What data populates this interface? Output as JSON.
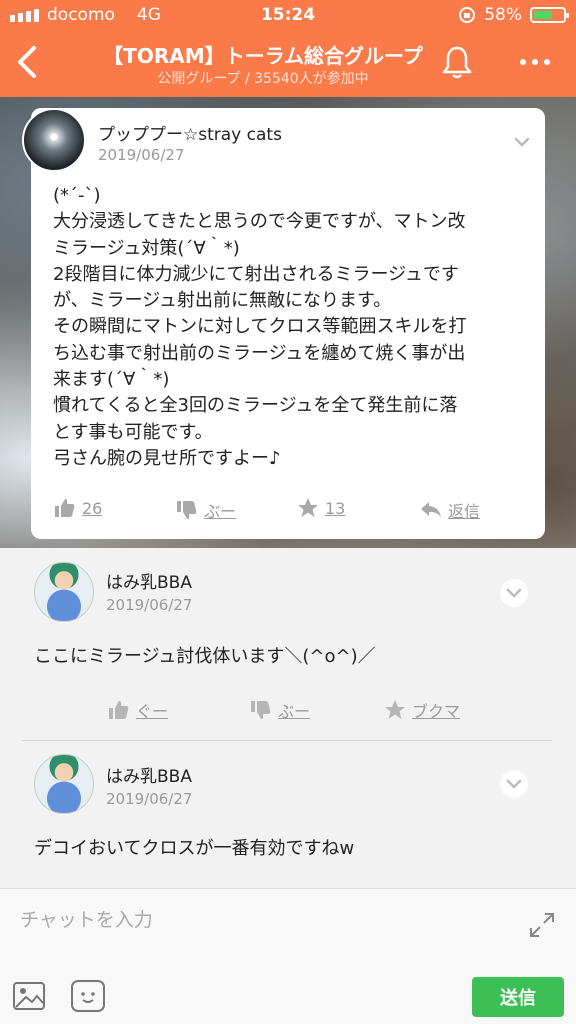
{
  "status": {
    "carrier": "docomo",
    "network": "4G",
    "time": "15:24",
    "battery": "58%"
  },
  "header": {
    "title": "【TORAM】トーラム総合グループ",
    "subtitle": "公開グループ / 35540人が参加中"
  },
  "post": {
    "author": "プッププー☆stray cats",
    "date": "2019/06/27",
    "lines": [
      "(*´-`)",
      "大分浸透してきたと思うので今更ですが、マトン改",
      "ミラージュ対策(´∀｀*)",
      "2段階目に体力減少にて射出されるミラージュです",
      "が、ミラージュ射出前に無敵になります。",
      "その瞬間にマトンに対してクロス等範囲スキルを打",
      "ち込む事で射出前のミラージュを纏めて焼く事が出",
      "来ます(´∀｀*)",
      "慣れてくると全3回のミラージュを全て発生前に落",
      "とす事も可能です。",
      "弓さん腕の見せ所ですよー♪"
    ],
    "likes": "26",
    "boo": "ぶー",
    "stars": "13",
    "reply": "返信"
  },
  "comments": [
    {
      "name": "はみ乳BBA",
      "date": "2019/06/27",
      "text": "ここにミラージュ討伐体います＼(^o^)／",
      "actions": {
        "good": "ぐー",
        "boo": "ぶー",
        "bookmark": "ブクマ"
      }
    },
    {
      "name": "はみ乳BBA",
      "date": "2019/06/27",
      "text": "デコイおいてクロスが一番有効ですねw"
    }
  ],
  "chat": {
    "placeholder": "チャットを入力",
    "send": "送信"
  },
  "colors": {
    "header": "#fb7a4a",
    "send": "#3cbf55",
    "battery": "#4cd964"
  },
  "icons": [
    "back-icon",
    "bell-icon",
    "more-icon",
    "thumbs-up-icon",
    "thumbs-down-icon",
    "star-icon",
    "reply-icon",
    "bookmark-icon",
    "chevron-down-icon",
    "expand-icon",
    "image-icon",
    "emoji-icon"
  ]
}
